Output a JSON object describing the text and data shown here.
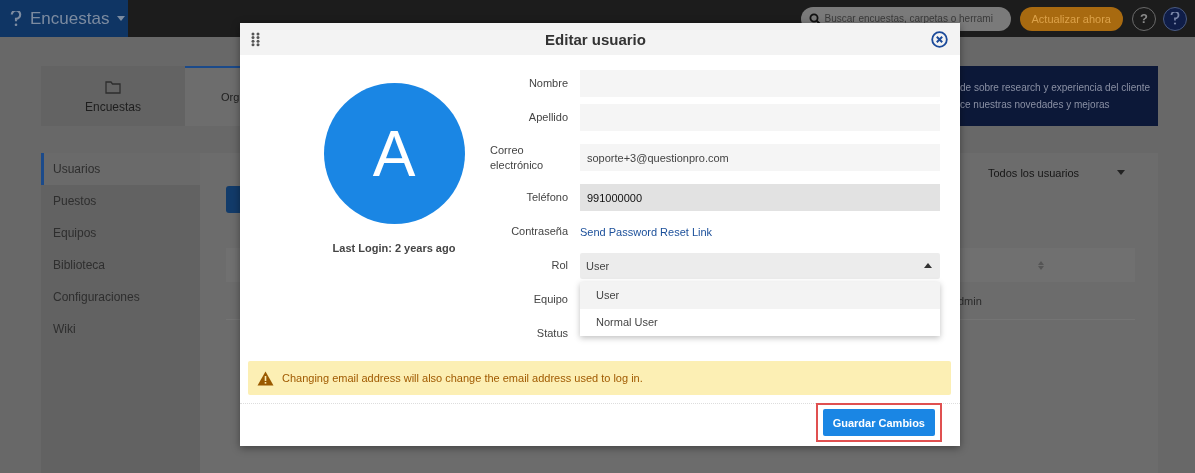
{
  "app_bar": {
    "app_name": "Encuestas",
    "search": {
      "placeholder": "Buscar encuestas, carpetas o herrami"
    },
    "upgrade_button": "Actualizar ahora",
    "help_button": "?"
  },
  "tabs": [
    {
      "label": "Encuestas",
      "selected": false
    },
    {
      "label": "Org",
      "selected": true
    }
  ],
  "banner": {
    "lines": [
      "de sobre research y experiencia del cliente",
      "ce nuestras novedades y mejoras"
    ]
  },
  "sidebar": {
    "items": [
      {
        "label": "Usuarios",
        "selected": true
      },
      {
        "label": "Puestos",
        "selected": false
      },
      {
        "label": "Equipos",
        "selected": false
      },
      {
        "label": "Biblioteca",
        "selected": false
      },
      {
        "label": "Configuraciones",
        "selected": false
      },
      {
        "label": "Wiki",
        "selected": false
      }
    ]
  },
  "filter": {
    "value": "Todos los usuarios"
  },
  "table": {
    "rows": [
      {
        "column_1": "dmin"
      }
    ]
  },
  "modal": {
    "title": "Editar usuario",
    "avatar_letter": "A",
    "last_login": "Last Login: 2 years ago",
    "fields": [
      {
        "label": "Nombre",
        "kind": "input",
        "focused": false
      },
      {
        "label": "Apellido",
        "kind": "input",
        "focused": false
      },
      {
        "label": "Correo electrónico",
        "kind": "input",
        "value": "soporte+3@questionpro.com",
        "focused": false
      },
      {
        "label": "Teléfono",
        "kind": "input",
        "value": "991000000",
        "focused": true
      },
      {
        "label": "Contraseña",
        "kind": "link",
        "value": "Send Password Reset Link"
      },
      {
        "label": "Rol",
        "kind": "select",
        "value": "User",
        "expanded": true,
        "options": [
          {
            "label": "User",
            "selected": true
          },
          {
            "label": "Normal User",
            "selected": false
          }
        ]
      },
      {
        "label": "Equipo",
        "kind": "covered"
      },
      {
        "label": "Status",
        "kind": "covered"
      }
    ],
    "alert": "Changing email address will also change the email address used to log in.",
    "save_button": "Guardar Cambios"
  }
}
